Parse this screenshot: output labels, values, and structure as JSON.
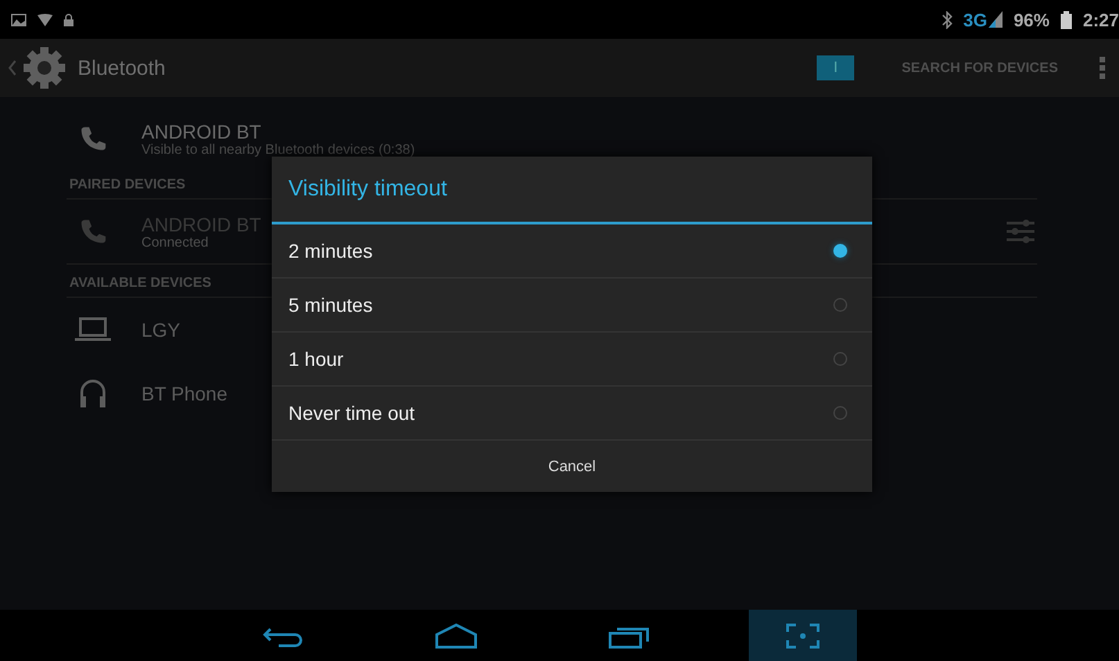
{
  "status_bar": {
    "carrier": "3G",
    "battery": "96%",
    "time": "2:27"
  },
  "action_bar": {
    "title": "Bluetooth",
    "toggle_label": "I",
    "action": "SEARCH FOR DEVICES"
  },
  "this_device": {
    "kind": "phone",
    "name": "ANDROID BT",
    "subtitle": "Visible to all nearby Bluetooth devices (0:38)"
  },
  "sections": [
    {
      "header": "PAIRED DEVICES",
      "devices": [
        {
          "kind": "phone",
          "name": "ANDROID BT",
          "subtitle": "Connected",
          "settings": true
        }
      ]
    },
    {
      "header": "AVAILABLE DEVICES",
      "devices": [
        {
          "kind": "laptop",
          "name": "LGY",
          "settings": false
        },
        {
          "kind": "headphones",
          "name": "BT Phone",
          "settings": false
        }
      ]
    }
  ],
  "dialog": {
    "title": "Visibility timeout",
    "options": [
      {
        "label": "2 minutes",
        "selected": true
      },
      {
        "label": "5 minutes",
        "selected": false
      },
      {
        "label": "1 hour",
        "selected": false
      },
      {
        "label": "Never time out",
        "selected": false
      }
    ],
    "button": "Cancel"
  },
  "nav_bar": {
    "buttons": [
      {
        "kind": "back",
        "pressed": false
      },
      {
        "kind": "home",
        "pressed": false
      },
      {
        "kind": "recents",
        "pressed": false
      },
      {
        "kind": "screenshot",
        "pressed": true
      }
    ]
  }
}
